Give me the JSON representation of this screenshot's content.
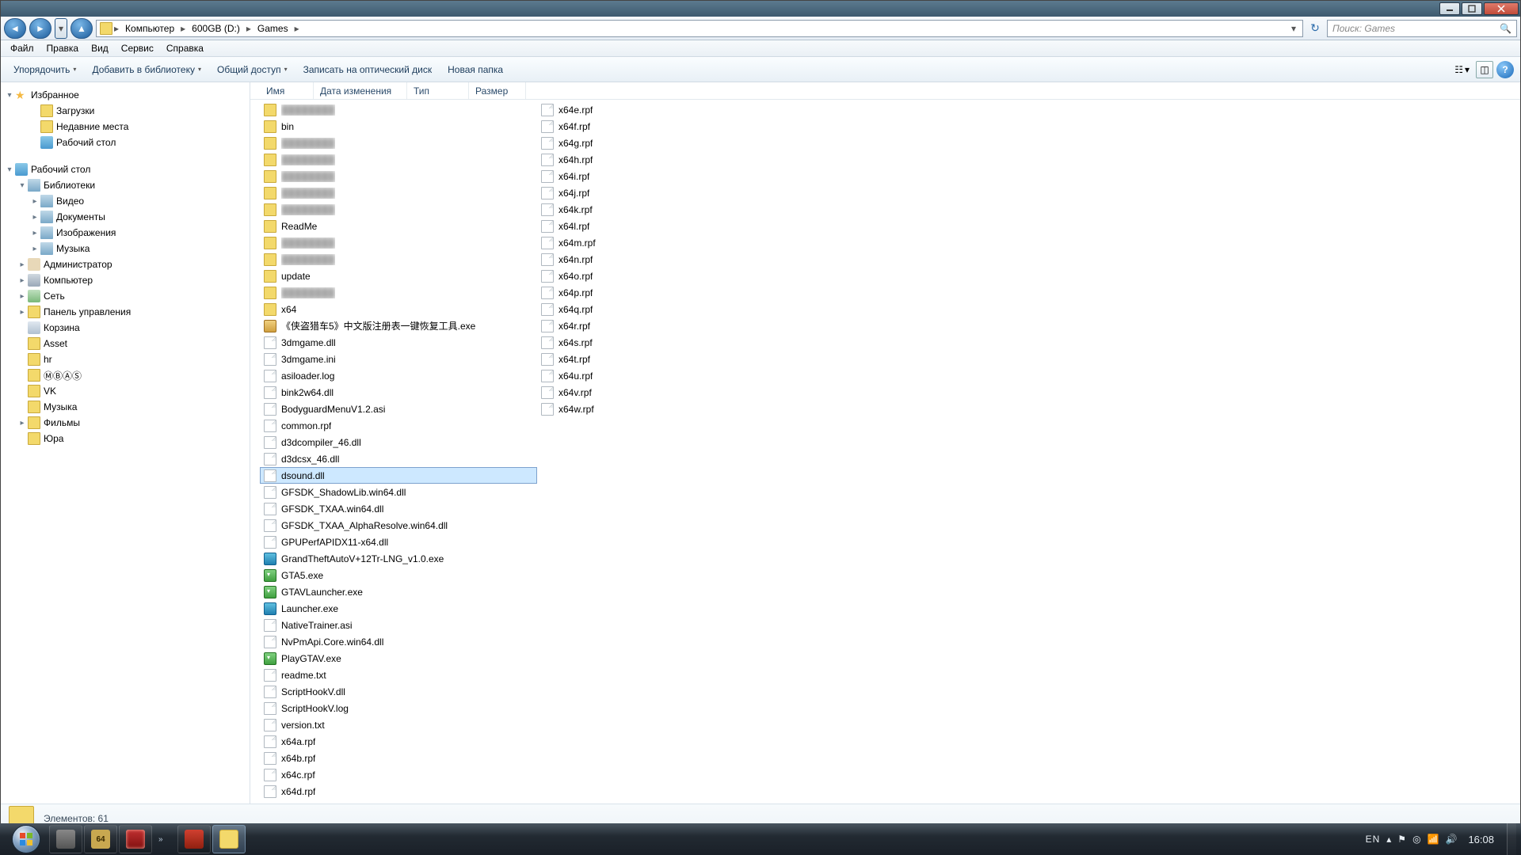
{
  "window": {
    "buttons": {
      "min": "–",
      "max": "☐",
      "close": "✕"
    }
  },
  "breadcrumb": {
    "items": [
      "Компьютер",
      "600GB (D:)",
      "Games"
    ]
  },
  "search": {
    "placeholder": "Поиск: Games"
  },
  "menu": [
    "Файл",
    "Правка",
    "Вид",
    "Сервис",
    "Справка"
  ],
  "toolbar": {
    "organize": "Упорядочить",
    "addlib": "Добавить в библиотеку",
    "share": "Общий доступ",
    "burn": "Записать на оптический диск",
    "newfolder": "Новая папка"
  },
  "tree": {
    "favorites": {
      "label": "Избранное",
      "children": [
        {
          "label": "Загрузки",
          "icon": "fold"
        },
        {
          "label": "Недавние места",
          "icon": "fold"
        },
        {
          "label": "Рабочий стол",
          "icon": "desk"
        }
      ]
    },
    "desktop": {
      "label": "Рабочий стол",
      "children": [
        {
          "label": "Библиотеки",
          "icon": "lib",
          "exp": true,
          "children": [
            {
              "label": "Видео",
              "icon": "lib"
            },
            {
              "label": "Документы",
              "icon": "lib"
            },
            {
              "label": "Изображения",
              "icon": "lib"
            },
            {
              "label": "Музыка",
              "icon": "lib"
            }
          ]
        },
        {
          "label": "Администратор",
          "icon": "usr",
          "exp": false
        },
        {
          "label": "Компьютер",
          "icon": "comp",
          "exp": false
        },
        {
          "label": "Сеть",
          "icon": "net",
          "exp": false
        },
        {
          "label": "Панель управления",
          "icon": "fold",
          "exp": false
        },
        {
          "label": "Корзина",
          "icon": "bin"
        },
        {
          "label": "Asset",
          "icon": "fold"
        },
        {
          "label": "hr",
          "icon": "fold"
        },
        {
          "label": "ⓂⒷⒶⓈ",
          "icon": "fold"
        },
        {
          "label": "VK",
          "icon": "fold"
        },
        {
          "label": "Музыка",
          "icon": "fold"
        },
        {
          "label": "Фильмы",
          "icon": "fold",
          "exp": false
        },
        {
          "label": "Юра",
          "icon": "fold"
        }
      ]
    }
  },
  "columns": {
    "name": "Имя",
    "date": "Дата изменения",
    "type": "Тип",
    "size": "Размер"
  },
  "files_col1": [
    {
      "t": "fold",
      "n": "",
      "blur": true
    },
    {
      "t": "fold",
      "n": "bin"
    },
    {
      "t": "fold",
      "n": "",
      "blur": true
    },
    {
      "t": "fold",
      "n": "",
      "blur": true
    },
    {
      "t": "fold",
      "n": "",
      "blur": true
    },
    {
      "t": "fold",
      "n": "",
      "blur": true
    },
    {
      "t": "fold",
      "n": "",
      "blur": true
    },
    {
      "t": "fold",
      "n": "ReadMe"
    },
    {
      "t": "fold",
      "n": "",
      "blur": true
    },
    {
      "t": "fold",
      "n": "",
      "blur": true
    },
    {
      "t": "fold",
      "n": "update"
    },
    {
      "t": "fold",
      "n": "",
      "blur": true
    },
    {
      "t": "fold",
      "n": "x64"
    },
    {
      "t": "exe",
      "n": "《侠盗猎车5》中文版注册表一键恢复工具.exe"
    },
    {
      "t": "file",
      "n": "3dmgame.dll"
    },
    {
      "t": "file",
      "n": "3dmgame.ini"
    },
    {
      "t": "file",
      "n": "asiloader.log"
    },
    {
      "t": "file",
      "n": "bink2w64.dll"
    },
    {
      "t": "file",
      "n": "BodyguardMenuV1.2.asi"
    },
    {
      "t": "file",
      "n": "common.rpf"
    },
    {
      "t": "file",
      "n": "d3dcompiler_46.dll"
    },
    {
      "t": "file",
      "n": "d3dcsx_46.dll"
    },
    {
      "t": "file",
      "n": "dsound.dll",
      "sel": true
    },
    {
      "t": "file",
      "n": "GFSDK_ShadowLib.win64.dll"
    },
    {
      "t": "file",
      "n": "GFSDK_TXAA.win64.dll"
    },
    {
      "t": "file",
      "n": "GFSDK_TXAA_AlphaResolve.win64.dll"
    },
    {
      "t": "file",
      "n": "GPUPerfAPIDX11-x64.dll"
    },
    {
      "t": "exe2",
      "n": "GrandTheftAutoV+12Tr-LNG_v1.0.exe"
    },
    {
      "t": "exe3",
      "n": "GTA5.exe"
    },
    {
      "t": "exe3",
      "n": "GTAVLauncher.exe"
    },
    {
      "t": "exe2",
      "n": "Launcher.exe"
    },
    {
      "t": "file",
      "n": "NativeTrainer.asi"
    },
    {
      "t": "file",
      "n": "NvPmApi.Core.win64.dll"
    },
    {
      "t": "exe3",
      "n": "PlayGTAV.exe"
    },
    {
      "t": "file",
      "n": "readme.txt"
    },
    {
      "t": "file",
      "n": "ScriptHookV.dll"
    },
    {
      "t": "file",
      "n": "ScriptHookV.log"
    },
    {
      "t": "file",
      "n": "version.txt"
    },
    {
      "t": "file",
      "n": "x64a.rpf"
    },
    {
      "t": "file",
      "n": "x64b.rpf"
    }
  ],
  "files_col2": [
    {
      "t": "file",
      "n": "x64c.rpf"
    },
    {
      "t": "file",
      "n": "x64d.rpf"
    },
    {
      "t": "file",
      "n": "x64e.rpf"
    },
    {
      "t": "file",
      "n": "x64f.rpf"
    },
    {
      "t": "file",
      "n": "x64g.rpf"
    },
    {
      "t": "file",
      "n": "x64h.rpf"
    },
    {
      "t": "file",
      "n": "x64i.rpf"
    },
    {
      "t": "file",
      "n": "x64j.rpf"
    },
    {
      "t": "file",
      "n": "x64k.rpf"
    },
    {
      "t": "file",
      "n": "x64l.rpf"
    },
    {
      "t": "file",
      "n": "x64m.rpf"
    },
    {
      "t": "file",
      "n": "x64n.rpf"
    },
    {
      "t": "file",
      "n": "x64o.rpf"
    },
    {
      "t": "file",
      "n": "x64p.rpf"
    },
    {
      "t": "file",
      "n": "x64q.rpf"
    },
    {
      "t": "file",
      "n": "x64r.rpf"
    },
    {
      "t": "file",
      "n": "x64s.rpf"
    },
    {
      "t": "file",
      "n": "x64t.rpf"
    },
    {
      "t": "file",
      "n": "x64u.rpf"
    },
    {
      "t": "file",
      "n": "x64v.rpf"
    },
    {
      "t": "file",
      "n": "x64w.rpf"
    }
  ],
  "status": {
    "count_label": "Элементов: 61"
  },
  "taskbar": {
    "items": [
      {
        "icon": "gray",
        "n": ""
      },
      {
        "icon": "fraps",
        "n": "64"
      },
      {
        "icon": "grn",
        "n": ""
      }
    ],
    "running": [
      {
        "icon": "red",
        "active": false
      },
      {
        "icon": "fold",
        "active": true
      }
    ],
    "lang": "EN",
    "clock": "16:08"
  }
}
